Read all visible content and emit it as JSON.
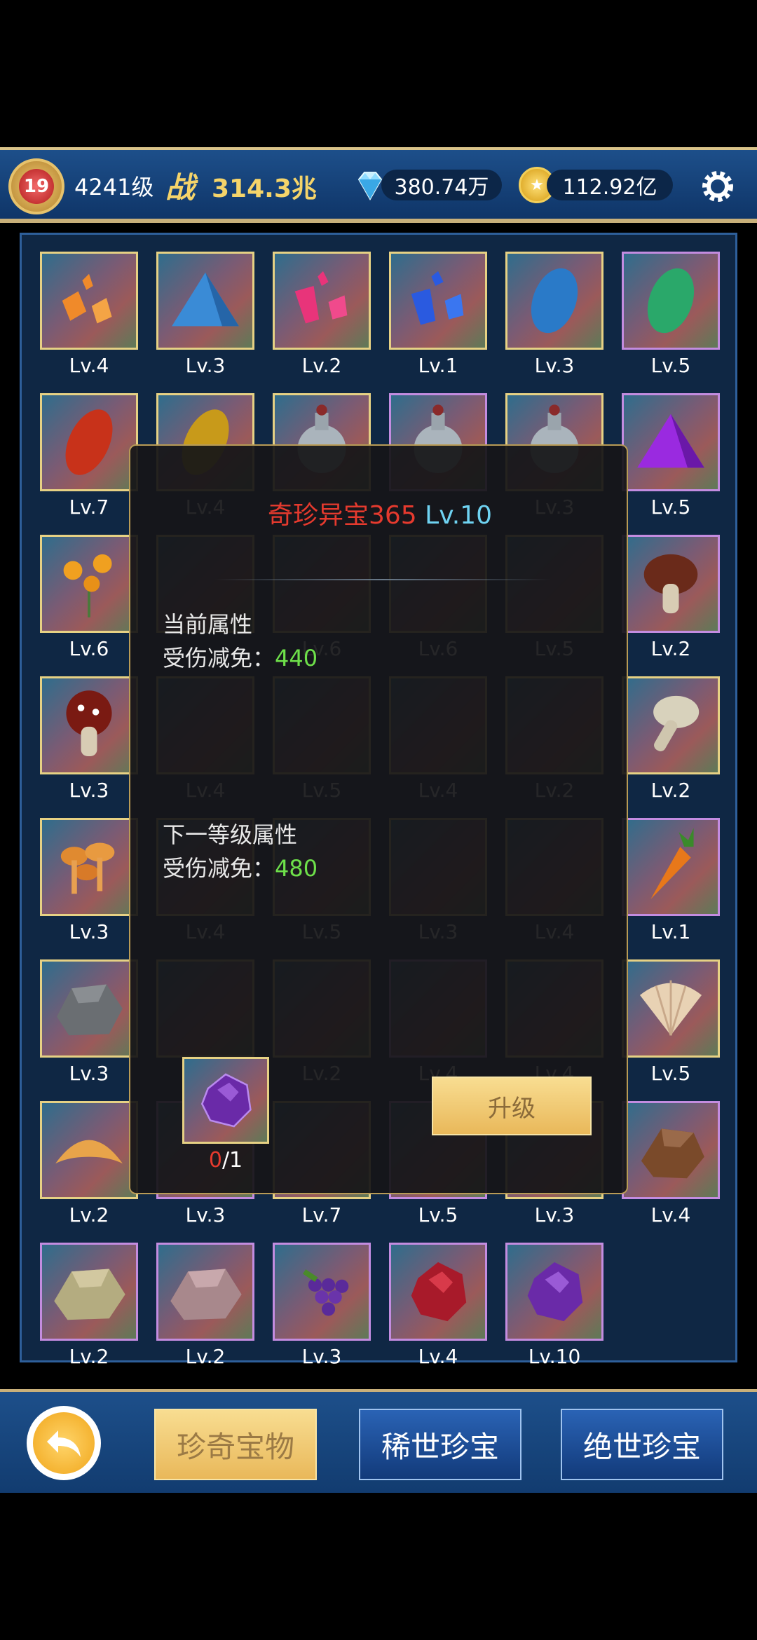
{
  "header": {
    "vip_level": "19",
    "player_level": "4241级",
    "power_icon_text": "战",
    "power_value": "314.3兆",
    "diamonds": "380.74万",
    "gold": "112.92亿",
    "icons": [
      "vip-badge-icon",
      "diamond-icon",
      "gold-coin-icon",
      "settings-gear-icon"
    ]
  },
  "grid": {
    "labels": [
      "Lv.4",
      "Lv.3",
      "Lv.2",
      "Lv.1",
      "Lv.3",
      "Lv.5",
      "Lv.7",
      "Lv.4",
      "",
      "",
      "Lv.3",
      "Lv.5",
      "Lv.6",
      "",
      "Lv.6",
      "Lv.6",
      "Lv.5",
      "Lv.2",
      "Lv.3",
      "Lv.4",
      "Lv.5",
      "Lv.4",
      "Lv.2",
      "Lv.2",
      "Lv.3",
      "Lv.4",
      "Lv.5",
      "Lv.3",
      "Lv.4",
      "Lv.1",
      "Lv.3",
      "",
      "Lv.2",
      "Lv.4",
      "Lv.4",
      "Lv.5",
      "Lv.2",
      "Lv.3",
      "Lv.7",
      "Lv.5",
      "Lv.3",
      "Lv.4",
      "Lv.2",
      "Lv.2",
      "Lv.3",
      "Lv.4",
      "Lv.10"
    ],
    "items": [
      "orange-crystal",
      "blue-pile",
      "pink-crystal",
      "blue-crystal",
      "blue-seed",
      "green-seed",
      "red-seed",
      "yellow-seed",
      "potion",
      "potion",
      "potion",
      "purple-pile",
      "yellow-flowers",
      "",
      "",
      "",
      "",
      "brown-mushroom",
      "red-mushroom",
      "",
      "",
      "",
      "",
      "white-mushroom",
      "orange-mushrooms",
      "",
      "",
      "",
      "",
      "carrot",
      "gray-stone",
      "",
      "",
      "",
      "",
      "seashell",
      "croissant",
      "",
      "",
      "",
      "",
      "brown-stone",
      "tan-stone",
      "mauve-stone",
      "grapes",
      "red-gem",
      "purple-gem"
    ]
  },
  "dialog": {
    "item_name": "奇珍异宝365",
    "item_level": "Lv.10",
    "current_header": "当前属性",
    "current_stat_label": "受伤减免：",
    "current_stat_value": "440",
    "next_header": "下一等级属性",
    "next_stat_label": "受伤减免：",
    "next_stat_value": "480",
    "material_have": "0",
    "material_need": "/1",
    "upgrade_label": "升级"
  },
  "footer": {
    "back_icon": "back-arrow-icon",
    "tabs": [
      "珍奇宝物",
      "稀世珍宝",
      "绝世珍宝"
    ],
    "active_tab": "珍奇宝物"
  },
  "colors": {
    "accent_gold": "#e9b85a",
    "item_name_red": "#e53a2e",
    "level_cyan": "#6fd3f2",
    "stat_green": "#6ee04a"
  }
}
